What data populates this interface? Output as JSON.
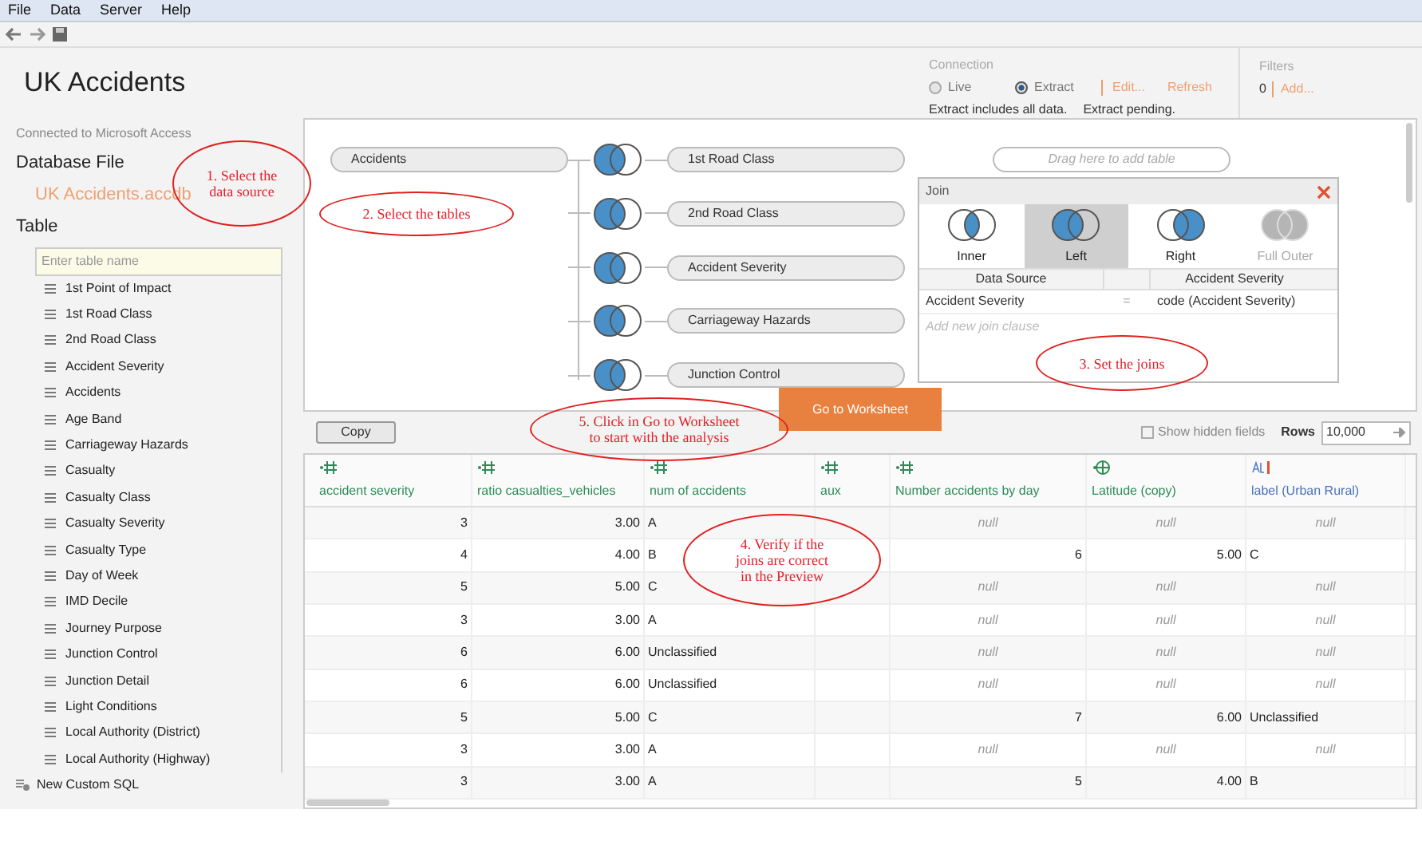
{
  "menu": [
    "File",
    "Data",
    "Server",
    "Help"
  ],
  "title": "UK Accidents",
  "connection": {
    "label": "Connection",
    "options": [
      {
        "label": "Live",
        "selected": false
      },
      {
        "label": "Extract",
        "selected": true
      }
    ],
    "links": [
      "Edit...",
      "Refresh"
    ],
    "notes": [
      "Extract includes all data.",
      "Extract pending."
    ]
  },
  "filters": {
    "label": "Filters",
    "count": "0",
    "link": "Add..."
  },
  "sidebar": {
    "connected": "Connected to Microsoft Access",
    "file_heading": "Database File",
    "file": "UK Accidents.accdb",
    "table_heading": "Table",
    "search": {
      "placeholder": "Enter table name"
    },
    "tables": [
      "1st Point of Impact",
      "1st Road Class",
      "2nd Road Class",
      "Accident Severity",
      "Accidents",
      "Age Band",
      "Carriageway Hazards",
      "Casualty",
      "Casualty Class",
      "Casualty Severity",
      "Casualty Type",
      "Day of Week",
      "IMD Decile",
      "Journey Purpose",
      "Junction Control",
      "Junction Detail",
      "Light Conditions",
      "Local Authority (District)",
      "Local Authority (Highway)"
    ],
    "custom_sql": "New Custom SQL"
  },
  "canvas": {
    "root": "Accidents",
    "joined": [
      "1st Road Class",
      "2nd Road Class",
      "Accident Severity",
      "Carriageway Hazards",
      "Junction Control"
    ],
    "drop_hint": "Drag here to add table"
  },
  "join_dialog": {
    "title": "Join",
    "types": [
      {
        "kind": "inner",
        "label": "Inner",
        "selected": false,
        "disabled": false
      },
      {
        "kind": "left",
        "label": "Left",
        "selected": true,
        "disabled": false
      },
      {
        "kind": "right",
        "label": "Right",
        "selected": false,
        "disabled": false
      },
      {
        "kind": "full",
        "label": "Full Outer",
        "selected": false,
        "disabled": true
      }
    ],
    "columns": [
      "Data Source",
      "Accident Severity"
    ],
    "clauses": [
      {
        "left": "Accident Severity",
        "op": "=",
        "right": "code (Accident Severity)"
      }
    ],
    "add_placeholder": "Add new join clause"
  },
  "go_button": "Go to Worksheet",
  "preview": {
    "copy": "Copy",
    "show_hidden": {
      "label": "Show hidden fields",
      "checked": false
    },
    "rows_label": "Rows",
    "rows_value": "10,000",
    "columns": [
      {
        "name": "accident severity",
        "kind": "number"
      },
      {
        "name": "ratio casualties_vehicles",
        "kind": "number"
      },
      {
        "name": "num of accidents",
        "kind": "number"
      },
      {
        "name": "aux",
        "kind": "number"
      },
      {
        "name": "Number accidents by day",
        "kind": "number"
      },
      {
        "name": "Latitude (copy)",
        "kind": "geo"
      },
      {
        "name": "label (Urban Rural)",
        "kind": "string"
      }
    ],
    "rows": [
      {
        "cells": [
          {
            "text": "3",
            "kind": "num"
          },
          {
            "text": "3.00",
            "kind": "num"
          },
          {
            "text": "A",
            "kind": "text"
          },
          {
            "kind": "empty"
          },
          {
            "text": "null",
            "kind": "null"
          },
          {
            "text": "null",
            "kind": "null"
          },
          {
            "text": "null",
            "kind": "null"
          }
        ]
      },
      {
        "cells": [
          {
            "text": "4",
            "kind": "num"
          },
          {
            "text": "4.00",
            "kind": "num"
          },
          {
            "text": "B",
            "kind": "text"
          },
          {
            "kind": "empty"
          },
          {
            "text": "6",
            "kind": "num"
          },
          {
            "text": "5.00",
            "kind": "num"
          },
          {
            "text": "C",
            "kind": "text"
          }
        ]
      },
      {
        "cells": [
          {
            "text": "5",
            "kind": "num"
          },
          {
            "text": "5.00",
            "kind": "num"
          },
          {
            "text": "C",
            "kind": "text"
          },
          {
            "kind": "empty"
          },
          {
            "text": "null",
            "kind": "null"
          },
          {
            "text": "null",
            "kind": "null"
          },
          {
            "text": "null",
            "kind": "null"
          }
        ]
      },
      {
        "cells": [
          {
            "text": "3",
            "kind": "num"
          },
          {
            "text": "3.00",
            "kind": "num"
          },
          {
            "text": "A",
            "kind": "text"
          },
          {
            "kind": "empty"
          },
          {
            "text": "null",
            "kind": "null"
          },
          {
            "text": "null",
            "kind": "null"
          },
          {
            "text": "null",
            "kind": "null"
          }
        ]
      },
      {
        "cells": [
          {
            "text": "6",
            "kind": "num"
          },
          {
            "text": "6.00",
            "kind": "num"
          },
          {
            "text": "Unclassified",
            "kind": "text"
          },
          {
            "kind": "empty"
          },
          {
            "text": "null",
            "kind": "null"
          },
          {
            "text": "null",
            "kind": "null"
          },
          {
            "text": "null",
            "kind": "null"
          }
        ]
      },
      {
        "cells": [
          {
            "text": "6",
            "kind": "num"
          },
          {
            "text": "6.00",
            "kind": "num"
          },
          {
            "text": "Unclassified",
            "kind": "text"
          },
          {
            "kind": "empty"
          },
          {
            "text": "null",
            "kind": "null"
          },
          {
            "text": "null",
            "kind": "null"
          },
          {
            "text": "null",
            "kind": "null"
          }
        ]
      },
      {
        "cells": [
          {
            "text": "5",
            "kind": "num"
          },
          {
            "text": "5.00",
            "kind": "num"
          },
          {
            "text": "C",
            "kind": "text"
          },
          {
            "kind": "empty"
          },
          {
            "text": "7",
            "kind": "num"
          },
          {
            "text": "6.00",
            "kind": "num"
          },
          {
            "text": "Unclassified",
            "kind": "text"
          }
        ]
      },
      {
        "cells": [
          {
            "text": "3",
            "kind": "num"
          },
          {
            "text": "3.00",
            "kind": "num"
          },
          {
            "text": "A",
            "kind": "text"
          },
          {
            "kind": "empty"
          },
          {
            "text": "null",
            "kind": "null"
          },
          {
            "text": "null",
            "kind": "null"
          },
          {
            "text": "null",
            "kind": "null"
          }
        ]
      },
      {
        "cells": [
          {
            "text": "3",
            "kind": "num"
          },
          {
            "text": "3.00",
            "kind": "num"
          },
          {
            "text": "A",
            "kind": "text"
          },
          {
            "kind": "empty"
          },
          {
            "text": "5",
            "kind": "num"
          },
          {
            "text": "4.00",
            "kind": "num"
          },
          {
            "text": "B",
            "kind": "text"
          }
        ]
      }
    ]
  },
  "annotations": [
    {
      "lines": [
        "1. Select the",
        "data source"
      ]
    },
    {
      "lines": [
        "2. Select the tables"
      ]
    },
    {
      "lines": [
        "3. Set the joins"
      ]
    },
    {
      "lines": [
        "4. Verify if the",
        "joins are correct",
        "in the Preview"
      ]
    },
    {
      "lines": [
        "5. Click in Go to Worksheet",
        "to start with the analysis"
      ]
    }
  ]
}
